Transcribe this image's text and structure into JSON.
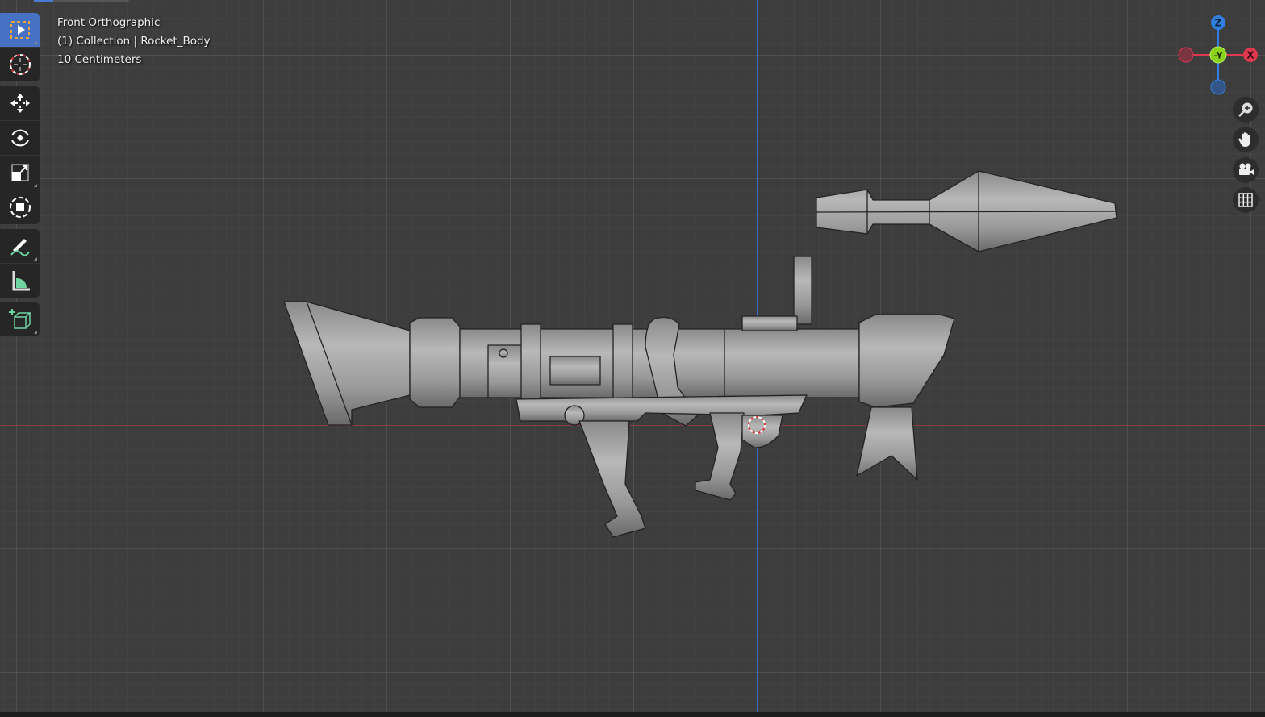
{
  "viewport": {
    "view_name": "Front Orthographic",
    "collection_info": "(1) Collection | Rocket_Body",
    "grid_scale": "10 Centimeters"
  },
  "gizmo": {
    "z_label": "Z",
    "y_label": "-Y",
    "x_label": "X",
    "colors": {
      "x": "#e0384f",
      "y": "#8bd21a",
      "z": "#2f7fe0"
    }
  },
  "toolbar": {
    "tools": [
      "select-box",
      "cursor",
      "move",
      "rotate",
      "scale",
      "transform",
      "annotate",
      "measure",
      "add-cube"
    ]
  },
  "nav": [
    "zoom",
    "pan",
    "camera",
    "toggle-ortho"
  ]
}
